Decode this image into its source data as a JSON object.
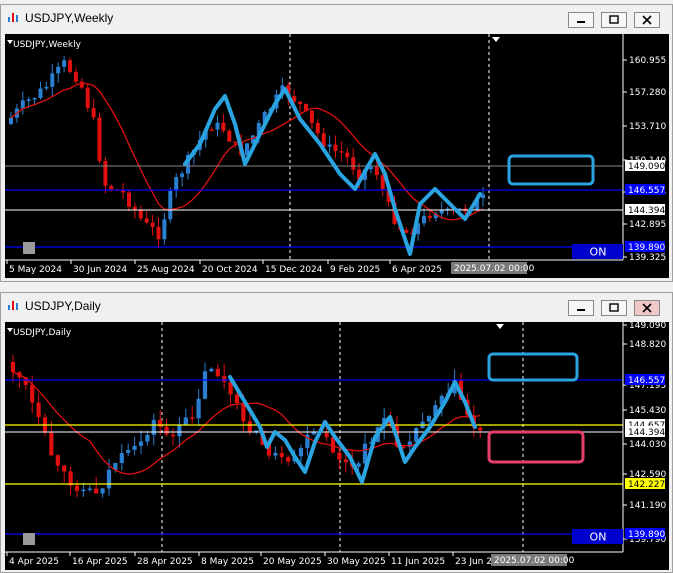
{
  "weekly": {
    "window_title": "USDJPY,Weekly",
    "symbol_label": "USDJPY,Weekly",
    "y_labels": [
      "160.955",
      "157.280",
      "153.710",
      "150.140",
      "146.555",
      "142.895",
      "139.325"
    ],
    "price_boxes": [
      {
        "label": "149.090",
        "bg": "#ffffff",
        "fg": "#000000"
      },
      {
        "label": "146.557",
        "bg": "#0000ff",
        "fg": "#ffffff"
      },
      {
        "label": "144.394",
        "bg": "#ffffff",
        "fg": "#000000"
      },
      {
        "label": "139.890",
        "bg": "#0000ff",
        "fg": "#ffffff"
      }
    ],
    "x_labels": [
      "5 May 2024",
      "30 Jun 2024",
      "25 Aug 2024",
      "20 Oct 2024",
      "15 Dec 2024",
      "9 Feb 2025",
      "6 Apr 2025"
    ],
    "date_box": "2025.07.02 00:00",
    "on_label": "ON"
  },
  "daily": {
    "window_title": "USDJPY,Daily",
    "symbol_label": "USDJPY,Daily",
    "y_labels": [
      "149.090",
      "148.820",
      "147.195",
      "145.430",
      "144.030",
      "142.590",
      "141.190",
      "139.790"
    ],
    "price_boxes": [
      {
        "label": "146.557",
        "bg": "#0000ff",
        "fg": "#ffffff"
      },
      {
        "label": "144.657",
        "bg": "#ffffff",
        "fg": "#000000"
      },
      {
        "label": "144.394",
        "bg": "#ffffff",
        "fg": "#000000"
      },
      {
        "label": "142.227",
        "bg": "#ffff00",
        "fg": "#000000"
      },
      {
        "label": "139.890",
        "bg": "#0000ff",
        "fg": "#ffffff"
      }
    ],
    "x_labels": [
      "4 Apr 2025",
      "16 Apr 2025",
      "28 Apr 2025",
      "8 May 2025",
      "20 May 2025",
      "30 May 2025",
      "11 Jun 2025",
      "23 Jun 2"
    ],
    "date_box": "2025.07.02 00:00",
    "on_label": "ON"
  },
  "colors": {
    "bull": "#2a7fd0",
    "bear": "#e01010",
    "ma": "#e01010",
    "hline_blue": "#0000ff",
    "hline_yellow": "#ffff00",
    "drawing": "#2aa4e0",
    "box_pink": "#e83e6c"
  }
}
